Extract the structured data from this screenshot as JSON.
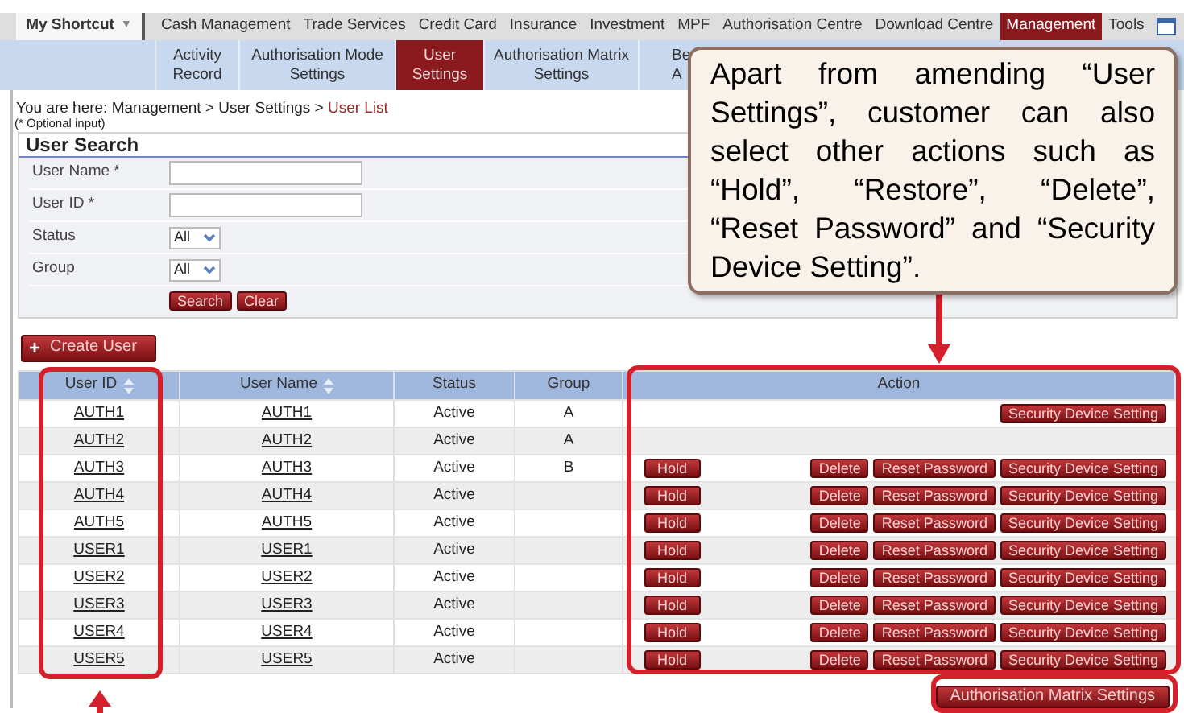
{
  "top_menu": {
    "shortcut": {
      "label": "My Shortcut",
      "caret": "▼"
    },
    "items": [
      {
        "label": "Cash Management",
        "selected": false
      },
      {
        "label": "Trade Services",
        "selected": false
      },
      {
        "label": "Credit Card",
        "selected": false
      },
      {
        "label": "Insurance",
        "selected": false
      },
      {
        "label": "Investment",
        "selected": false
      },
      {
        "label": "MPF",
        "selected": false
      },
      {
        "label": "Authorisation Centre",
        "selected": false
      },
      {
        "label": "Download Centre",
        "selected": false
      },
      {
        "label": "Management",
        "selected": true
      },
      {
        "label": "Tools",
        "selected": false
      }
    ]
  },
  "sub_menu": [
    {
      "lines": [
        "Activity",
        "Record"
      ],
      "selected": false
    },
    {
      "lines": [
        "Authorisation Mode",
        "Settings"
      ],
      "selected": false
    },
    {
      "lines": [
        "User",
        "Settings"
      ],
      "selected": true
    },
    {
      "lines": [
        "Authorisation Matrix",
        "Settings"
      ],
      "selected": false
    },
    {
      "lines": [
        "Be",
        "A"
      ],
      "selected": false
    }
  ],
  "breadcrumb": {
    "prefix": "You are here: Management > User Settings > ",
    "current": "User List"
  },
  "optional_note": "(* Optional input)",
  "search": {
    "title": "User Search",
    "fields": [
      {
        "label": "User Name *",
        "kind": "text"
      },
      {
        "label": "User ID *",
        "kind": "text"
      },
      {
        "label": "Status",
        "kind": "select",
        "value": "All"
      },
      {
        "label": "Group",
        "kind": "select",
        "value": "All"
      }
    ],
    "buttons": [
      "Search",
      "Clear"
    ]
  },
  "create_button": {
    "icon": "+",
    "label": "Create User"
  },
  "table": {
    "columns": [
      {
        "label": "User ID",
        "sortable": true
      },
      {
        "label": "User Name",
        "sortable": true
      },
      {
        "label": "Status",
        "sortable": false
      },
      {
        "label": "Group",
        "sortable": false
      },
      {
        "label": "Action",
        "sortable": false
      }
    ],
    "rows": [
      {
        "id": "AUTH1",
        "name": "AUTH1",
        "status": "Active",
        "group": "A",
        "left_actions": [],
        "right_actions": [
          "Security Device Setting"
        ]
      },
      {
        "id": "AUTH2",
        "name": "AUTH2",
        "status": "Active",
        "group": "A",
        "left_actions": [],
        "right_actions": []
      },
      {
        "id": "AUTH3",
        "name": "AUTH3",
        "status": "Active",
        "group": "B",
        "left_actions": [
          "Hold"
        ],
        "right_actions": [
          "Delete",
          "Reset Password",
          "Security Device Setting"
        ]
      },
      {
        "id": "AUTH4",
        "name": "AUTH4",
        "status": "Active",
        "group": "",
        "left_actions": [
          "Hold"
        ],
        "right_actions": [
          "Delete",
          "Reset Password",
          "Security Device Setting"
        ]
      },
      {
        "id": "AUTH5",
        "name": "AUTH5",
        "status": "Active",
        "group": "",
        "left_actions": [
          "Hold"
        ],
        "right_actions": [
          "Delete",
          "Reset Password",
          "Security Device Setting"
        ]
      },
      {
        "id": "USER1",
        "name": "USER1",
        "status": "Active",
        "group": "",
        "left_actions": [
          "Hold"
        ],
        "right_actions": [
          "Delete",
          "Reset Password",
          "Security Device Setting"
        ]
      },
      {
        "id": "USER2",
        "name": "USER2",
        "status": "Active",
        "group": "",
        "left_actions": [
          "Hold"
        ],
        "right_actions": [
          "Delete",
          "Reset Password",
          "Security Device Setting"
        ]
      },
      {
        "id": "USER3",
        "name": "USER3",
        "status": "Active",
        "group": "",
        "left_actions": [
          "Hold"
        ],
        "right_actions": [
          "Delete",
          "Reset Password",
          "Security Device Setting"
        ]
      },
      {
        "id": "USER4",
        "name": "USER4",
        "status": "Active",
        "group": "",
        "left_actions": [
          "Hold"
        ],
        "right_actions": [
          "Delete",
          "Reset Password",
          "Security Device Setting"
        ]
      },
      {
        "id": "USER5",
        "name": "USER5",
        "status": "Active",
        "group": "",
        "left_actions": [
          "Hold"
        ],
        "right_actions": [
          "Delete",
          "Reset Password",
          "Security Device Setting"
        ]
      }
    ]
  },
  "matrix_button": "Authorisation Matrix Settings",
  "callout": "Apart from amending “User Settings”, customer can also select other actions such as “Hold”, “Restore”, “Delete”, “Reset Password” and “Security Device Setting”."
}
